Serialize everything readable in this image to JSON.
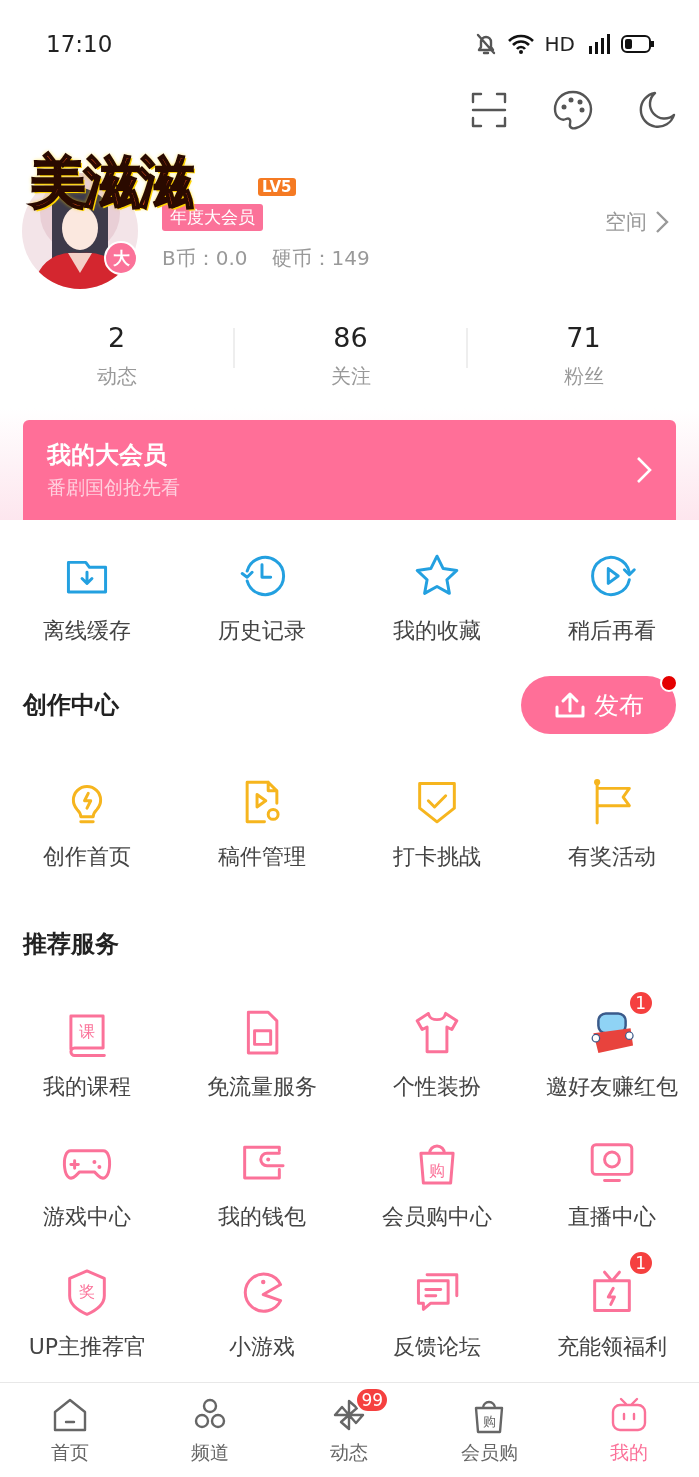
{
  "status_bar": {
    "time": "17:10",
    "network": "HD"
  },
  "profile": {
    "pendant_text": "美滋滋",
    "level": "LV5",
    "avatar_badge": "大",
    "vip_tag": "年度大会员",
    "space_link": "空间",
    "b_coins": "B币：0.0",
    "coins": "硬币：149"
  },
  "stats": [
    {
      "value": "2",
      "label": "动态"
    },
    {
      "value": "86",
      "label": "关注"
    },
    {
      "value": "71",
      "label": "粉丝"
    }
  ],
  "vip_banner": {
    "title": "我的大会员",
    "subtitle": "番剧国创抢先看"
  },
  "quick_actions": [
    {
      "label": "离线缓存"
    },
    {
      "label": "历史记录"
    },
    {
      "label": "我的收藏"
    },
    {
      "label": "稍后再看"
    }
  ],
  "creation": {
    "title": "创作中心",
    "publish_button": "发布",
    "publish_dot": true,
    "items": [
      {
        "label": "创作首页"
      },
      {
        "label": "稿件管理"
      },
      {
        "label": "打卡挑战"
      },
      {
        "label": "有奖活动"
      }
    ]
  },
  "services": {
    "title": "推荐服务",
    "items": [
      {
        "label": "我的课程",
        "icon_text": "课"
      },
      {
        "label": "免流量服务"
      },
      {
        "label": "个性装扮"
      },
      {
        "label": "邀好友赚红包",
        "badge": "1"
      },
      {
        "label": "游戏中心"
      },
      {
        "label": "我的钱包"
      },
      {
        "label": "会员购中心",
        "icon_text": "购"
      },
      {
        "label": "直播中心"
      },
      {
        "label": "UP主推荐官",
        "icon_text": "奖"
      },
      {
        "label": "小游戏"
      },
      {
        "label": "反馈论坛"
      },
      {
        "label": "充能领福利",
        "badge": "1"
      }
    ]
  },
  "tab_bar": [
    {
      "label": "首页",
      "selected": false
    },
    {
      "label": "频道",
      "selected": false
    },
    {
      "label": "动态",
      "selected": false,
      "badge": "99"
    },
    {
      "label": "会员购",
      "selected": false,
      "icon_text": "购"
    },
    {
      "label": "我的",
      "selected": true
    }
  ]
}
